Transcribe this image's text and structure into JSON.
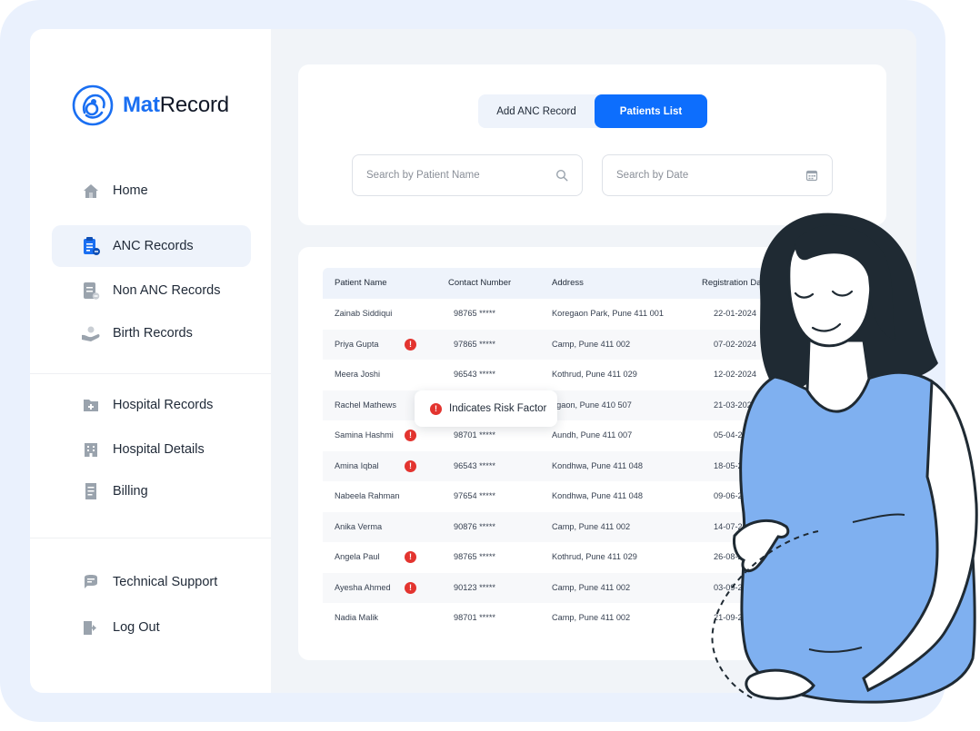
{
  "brand": {
    "name_accent": "Mat",
    "name_rest": "Record",
    "accent_color": "#1a6ff2"
  },
  "sidebar": {
    "items": [
      {
        "label": "Home",
        "icon": "home-icon"
      },
      {
        "label": "ANC Records",
        "icon": "clipboard-icon",
        "active": true
      },
      {
        "label": "Non ANC Records",
        "icon": "document-icon"
      },
      {
        "label": "Birth Records",
        "icon": "hand-baby-icon"
      },
      {
        "label": "Hospital Records",
        "icon": "folder-plus-icon"
      },
      {
        "label": "Hospital Details",
        "icon": "building-icon"
      },
      {
        "label": "Billing",
        "icon": "receipt-icon"
      },
      {
        "label": "Technical Support",
        "icon": "chat-support-icon"
      },
      {
        "label": "Log Out",
        "icon": "logout-icon"
      }
    ]
  },
  "tabs": [
    {
      "label": "Add ANC Record",
      "active": false
    },
    {
      "label": "Patients List",
      "active": true
    }
  ],
  "search": {
    "name_placeholder": "Search by Patient Name",
    "date_placeholder": "Search by Date"
  },
  "table": {
    "columns": [
      "Patient Name",
      "Contact Number",
      "Address",
      "Registration Date"
    ],
    "rows": [
      {
        "name": "Zainab Siddiqui",
        "risk": false,
        "contact": "98765 *****",
        "address": "Koregaon Park, Pune 411 001",
        "date": "22-01-2024"
      },
      {
        "name": "Priya Gupta",
        "risk": true,
        "contact": "97865 *****",
        "address": "Camp, Pune 411 002",
        "date": "07-02-2024"
      },
      {
        "name": "Meera Joshi",
        "risk": false,
        "contact": "96543 *****",
        "address": "Kothrud, Pune 411 029",
        "date": "12-02-2024"
      },
      {
        "name": "Rachel Mathews",
        "risk": false,
        "contact": "",
        "address": "egaon, Pune 410 507",
        "date": "21-03-2024"
      },
      {
        "name": "Samina Hashmi",
        "risk": true,
        "contact": "98701 *****",
        "address": "Aundh, Pune 411 007",
        "date": "05-04-2024"
      },
      {
        "name": "Amina Iqbal",
        "risk": true,
        "contact": "96543 *****",
        "address": "Kondhwa, Pune 411 048",
        "date": "18-05-2024"
      },
      {
        "name": "Nabeela Rahman",
        "risk": false,
        "contact": "97654 *****",
        "address": "Kondhwa, Pune 411 048",
        "date": "09-06-2024"
      },
      {
        "name": "Anika Verma",
        "risk": false,
        "contact": "90876 *****",
        "address": "Camp, Pune 411 002",
        "date": "14-07-2024"
      },
      {
        "name": "Angela Paul",
        "risk": true,
        "contact": "98765 *****",
        "address": "Kothrud, Pune 411 029",
        "date": "26-08-2024"
      },
      {
        "name": "Ayesha Ahmed",
        "risk": true,
        "contact": "90123 *****",
        "address": "Camp, Pune 411 002",
        "date": "03-09-2024"
      },
      {
        "name": "Nadia Malik",
        "risk": false,
        "contact": "98701 *****",
        "address": "Camp, Pune 411 002",
        "date": "21-09-2024"
      }
    ]
  },
  "tooltip": {
    "text": "Indicates Risk Factor",
    "icon": "alert-icon"
  },
  "risk_glyph": "!",
  "colors": {
    "primary": "#0d6efd",
    "risk": "#e3342f",
    "skin": "#ffffff",
    "dress": "#7fb0f0",
    "hair": "#1f2a33"
  }
}
